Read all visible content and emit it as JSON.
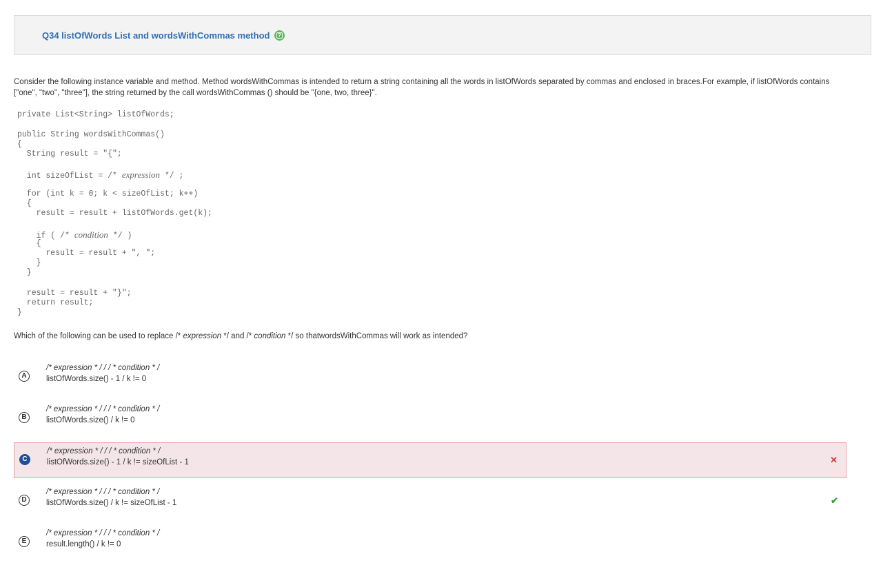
{
  "header": {
    "title": "Q34 listOfWords List and wordsWithCommas method",
    "help_icon": "help-icon"
  },
  "prompt": {
    "line1": "Consider the following instance variable and method. Method wordsWithCommas is intended to return a string containing all the words in listOfWords separated by commas and enclosed in braces.For example, if listOfWords contains",
    "line2": "[\"one\", \"two\", \"three\"], the string returned by the call wordsWithCommas () should be \"{one, two, three}\"."
  },
  "code": {
    "l1": "private List<String> listOfWords;",
    "l2": "public String wordsWithCommas()",
    "l3": "{",
    "l4": "  String result = \"{\";",
    "l5a": "  int sizeOfList = /* ",
    "l5b": "expression",
    "l5c": " */ ;",
    "l6": "  for (int k = 0; k < sizeOfList; k++)",
    "l7": "  {",
    "l8": "    result = result + listOfWords.get(k);",
    "l9a": "    if ( /* ",
    "l9b": "condition",
    "l9c": " */ )",
    "l10": "    {",
    "l11": "      result = result + \", \";",
    "l12": "    }",
    "l13": "  }",
    "l14": "  result = result + \"}\";",
    "l15": "  return result;",
    "l16": "}"
  },
  "question": {
    "p1": "Which of the following can be used to replace /* ",
    "p2": "expression",
    "p3": " */ and /* ",
    "p4": "condition",
    "p5": " */ so thatwordsWithCommas will work as intended?"
  },
  "options": [
    {
      "letter": "A",
      "line1": "/* expression * / / / * condition * /",
      "line2": "listOfWords.size() - 1 / k != 0",
      "state": "none"
    },
    {
      "letter": "B",
      "line1": "/* expression * / / / * condition * /",
      "line2": "listOfWords.size() / k != 0",
      "state": "none"
    },
    {
      "letter": "C",
      "line1": "/* expression * / / / * condition * /",
      "line2": "listOfWords.size() - 1 / k != sizeOfList - 1",
      "state": "selected-wrong",
      "mark": "✕"
    },
    {
      "letter": "D",
      "line1": "/* expression * / / / * condition * /",
      "line2": "listOfWords.size() / k != sizeOfList - 1",
      "state": "correct",
      "mark": "✔"
    },
    {
      "letter": "E",
      "line1": "/* expression * / / / * condition * /",
      "line2": "result.length() / k != 0",
      "state": "none"
    }
  ],
  "colors": {
    "title": "#2f6fb5",
    "help": "#5bb85b",
    "wrong_bg": "#f4e6e8",
    "wrong_border": "#e8a0aa",
    "selected_letter": "#1f4f96",
    "wrong_mark": "#d23b3b",
    "right_mark": "#3b9a3b"
  }
}
